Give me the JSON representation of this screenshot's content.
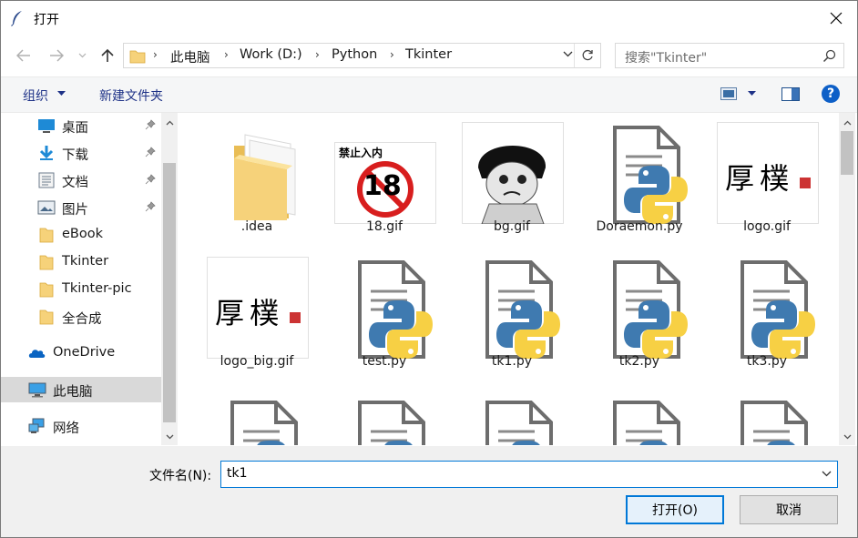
{
  "window": {
    "title": "打开"
  },
  "address": {
    "crumbs": [
      "此电脑",
      "Work (D:)",
      "Python",
      "Tkinter"
    ]
  },
  "search": {
    "placeholder": "搜索\"Tkinter\""
  },
  "toolbar": {
    "organize_label": "组织",
    "new_folder_label": "新建文件夹"
  },
  "sidebar": {
    "items": [
      {
        "label": "桌面",
        "icon": "desktop-icon",
        "pinned": true
      },
      {
        "label": "下载",
        "icon": "download-icon",
        "pinned": true
      },
      {
        "label": "文档",
        "icon": "document-icon",
        "pinned": true
      },
      {
        "label": "图片",
        "icon": "pictures-icon",
        "pinned": true
      },
      {
        "label": "eBook",
        "icon": "folder-icon",
        "pinned": false
      },
      {
        "label": "Tkinter",
        "icon": "folder-icon",
        "pinned": false
      },
      {
        "label": "Tkinter-pic",
        "icon": "folder-icon",
        "pinned": false
      },
      {
        "label": "全合成",
        "icon": "folder-icon",
        "pinned": false
      },
      {
        "label": "OneDrive",
        "icon": "onedrive-icon",
        "pinned": false
      },
      {
        "label": "此电脑",
        "icon": "this-pc-icon",
        "pinned": false,
        "selected": true
      },
      {
        "label": "网络",
        "icon": "network-icon",
        "pinned": false
      }
    ]
  },
  "files": [
    {
      "name": ".idea",
      "kind": "folder"
    },
    {
      "name": "18.gif",
      "kind": "gif-18",
      "thumb_text": "禁止入内",
      "thumb_number": "18"
    },
    {
      "name": "bg.gif",
      "kind": "gif-face"
    },
    {
      "name": "Doraemon.py",
      "kind": "py"
    },
    {
      "name": "logo.gif",
      "kind": "gif-logo",
      "thumb_text": "厚樸"
    },
    {
      "name": "logo_big.gif",
      "kind": "gif-logo",
      "thumb_text": "厚樸"
    },
    {
      "name": "test.py",
      "kind": "py"
    },
    {
      "name": "tk1.py",
      "kind": "py"
    },
    {
      "name": "tk2.py",
      "kind": "py"
    },
    {
      "name": "tk3.py",
      "kind": "py"
    },
    {
      "name": "",
      "kind": "py"
    },
    {
      "name": "",
      "kind": "py"
    },
    {
      "name": "",
      "kind": "py"
    },
    {
      "name": "",
      "kind": "py"
    },
    {
      "name": "",
      "kind": "py"
    }
  ],
  "filename": {
    "label": "文件名(N):",
    "value": "tk1"
  },
  "buttons": {
    "open": "打开(O)",
    "cancel": "取消"
  },
  "colors": {
    "accent": "#0078d7",
    "folder": "#f6d27a",
    "python_blue": "#3f7ab0",
    "python_yellow": "#f7d044",
    "selected": "#d9d9d9"
  }
}
